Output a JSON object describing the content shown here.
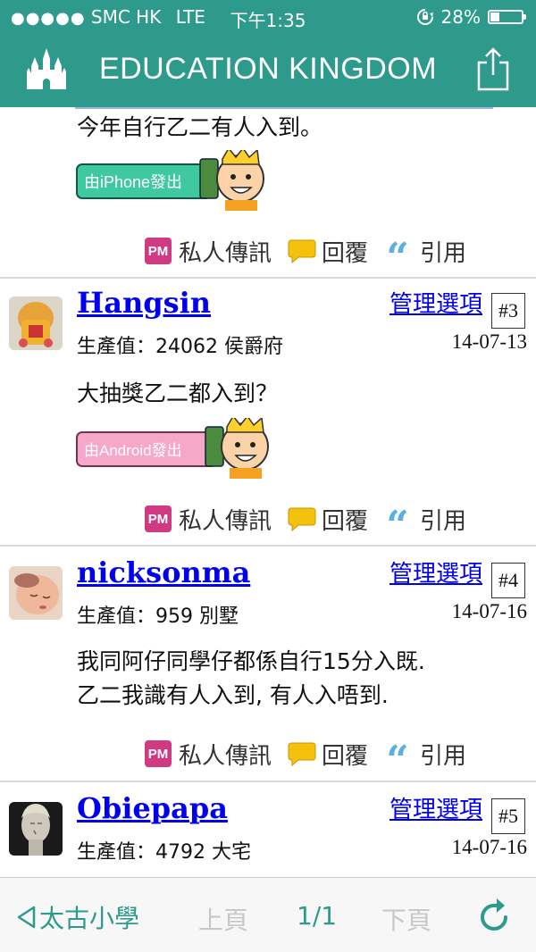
{
  "status_bar": {
    "carrier": "SMC HK",
    "network": "LTE",
    "time": "下午1:35",
    "battery": "28%",
    "battery_level": 0.28
  },
  "header": {
    "title": "EDUCATION KINGDOM"
  },
  "colors": {
    "accent": "#2e9a8c",
    "link": "#0000ee",
    "pm": "#d03a82",
    "quote": "#5ab0e0",
    "reply": "#f4c20d"
  },
  "fragment": {
    "message": "今年自行乙二有人入到。",
    "badge_text": "由iPhone發出"
  },
  "actions": {
    "pm": "私人傳訊",
    "pm_icon": "PM",
    "reply": "回覆",
    "quote": "引用"
  },
  "posts": [
    {
      "username": "Hangsin",
      "manage": "管理選項",
      "number": "#3",
      "production": "生產值：24062 侯爵府",
      "date": "14-07-13",
      "lines": [
        "大抽獎乙二都入到？"
      ],
      "badge_text": "由Android發出"
    },
    {
      "username": "nicksonma",
      "manage": "管理選項",
      "number": "#4",
      "production": "生產值：959 別墅",
      "date": "14-07-16",
      "lines": [
        "我同阿仔同學仔都係自行15分入既.",
        "乙二我識有人入到, 有人入唔到."
      ]
    },
    {
      "username": "Obiepapa",
      "manage": "管理選項",
      "number": "#5",
      "production": "生產值：4792 大宅",
      "date": "14-07-16"
    }
  ],
  "bottom_bar": {
    "back": "太古小學",
    "prev": "上頁",
    "page": "1/1",
    "next": "下頁"
  }
}
